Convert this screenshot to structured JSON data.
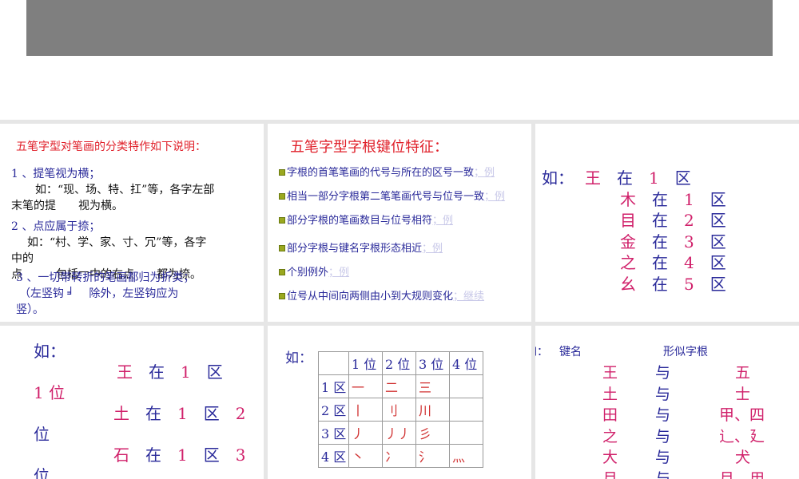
{
  "slide1": {
    "title": "五笔字型对笔画的分类特作如下说明：",
    "p1": "1 、提笔视为横；",
    "p1a": "如：“现、场、特、扛”等，各字左部",
    "p1b": "末笔的提　　视为横。",
    "p2": "2 、点应属于捺；",
    "p2a": "如：“村、学、家、寸、冗”等，各字",
    "p2b": "中的",
    "p2c": "点　　　包括冖中的右点　　都为捺。",
    "p3": "3 、一切带转折的笔画都归为折类；",
    "p3a": "（左竖钩 ╛　 除外，左竖钩应为",
    "p3b": "竖）。"
  },
  "slide2": {
    "title": "五笔字型字根键位特征：",
    "items": [
      {
        "text": "字根的首笔笔画的代号与所在的区号一致",
        "link": "；例"
      },
      {
        "text": "相当一部分字根第二笔笔画代号与位号一致",
        "link": "；例"
      },
      {
        "text": "部分字根的笔画数目与位号相符",
        "link": "；例"
      },
      {
        "text": "部分字根与键名字根形态相近",
        "link": "；例"
      },
      {
        "text": "个别例外",
        "link": "；例"
      },
      {
        "text": "位号从中间向两侧由小到大规则变化",
        "link": "；继续"
      }
    ]
  },
  "slide3": {
    "label": "如：",
    "rows": [
      [
        "王",
        "在",
        "1",
        "区"
      ],
      [
        "木",
        "在",
        "1",
        "区"
      ],
      [
        "目",
        "在",
        "2",
        "区"
      ],
      [
        "金",
        "在",
        "3",
        "区"
      ],
      [
        "之",
        "在",
        "4",
        "区"
      ],
      [
        "幺",
        "在",
        "5",
        "区"
      ]
    ]
  },
  "slide4": {
    "label": "如：",
    "r1": [
      "王",
      "在",
      "1",
      "区"
    ],
    "w1": "1 位",
    "r2": [
      "土",
      "在",
      "1",
      "区",
      "2"
    ],
    "w2": "位",
    "r3": [
      "石",
      "在",
      "1",
      "区",
      "3"
    ],
    "w3": "位"
  },
  "slide5": {
    "label": "如：",
    "header": [
      "",
      "1 位",
      "2 位",
      "3 位",
      "4 位"
    ],
    "rows": [
      [
        "1 区",
        "一",
        "二",
        "三",
        ""
      ],
      [
        "2 区",
        "丨",
        "刂",
        "川",
        ""
      ],
      [
        "3 区",
        "丿",
        "丿丿",
        "彡",
        ""
      ],
      [
        "4 区",
        "丶",
        "冫",
        "氵",
        "灬"
      ]
    ]
  },
  "slide6": {
    "label": "如：",
    "h1": "键名",
    "h2": "形似字根",
    "rows": [
      [
        "王",
        "与",
        "五"
      ],
      [
        "土",
        "与",
        "士"
      ],
      [
        "田",
        "与",
        "甲、四"
      ],
      [
        "之",
        "与",
        "辶、廴"
      ],
      [
        "大",
        "与",
        "犬"
      ],
      [
        "月",
        "与",
        "月、用"
      ]
    ]
  }
}
